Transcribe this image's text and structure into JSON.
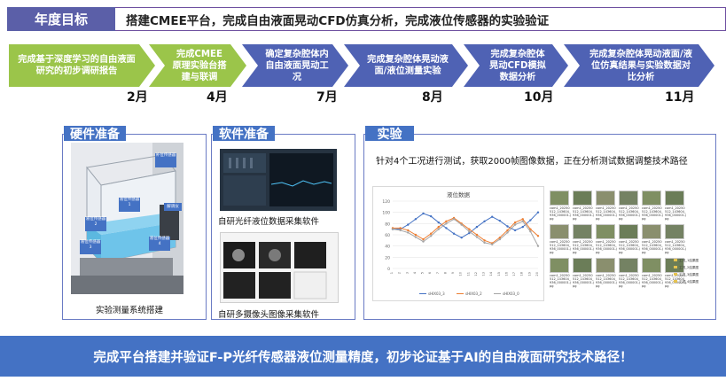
{
  "header": {
    "goal_label": "年度目标",
    "goal_text": "搭建CMEE平台，完成自由液面晃动CFD仿真分析，完成液位传感器的实验验证"
  },
  "timeline": [
    {
      "text": "完成基于深度学习的自由液面研究的初步调研报告",
      "month": "2月",
      "status": "done"
    },
    {
      "text": "完成CMEE原理实验台搭建与联调",
      "month": "4月",
      "status": "done"
    },
    {
      "text": "确定复杂腔体内自由液面晃动工况",
      "month": "7月",
      "status": "planned"
    },
    {
      "text": "完成复杂腔体晃动液面/液位测量实验",
      "month": "8月",
      "status": "planned"
    },
    {
      "text": "完成复杂腔体晃动CFD模拟数据分析",
      "month": "10月",
      "status": "planned"
    },
    {
      "text": "完成复杂腔体晃动液面/液位仿真结果与实验数据对比分析",
      "month": "11月",
      "status": "planned"
    }
  ],
  "hardware": {
    "tab": "硬件准备",
    "caption": "实验测量系统搭建",
    "labels": [
      "补位传感器",
      "液位传感器1",
      "液位传感器2",
      "液位传感器3",
      "液位传感器4",
      "解调仪"
    ]
  },
  "software": {
    "tab": "软件准备",
    "caption_top": "自研光纤液位数据采集软件",
    "caption_bottom": "自研多摄像头图像采集软件"
  },
  "experiment": {
    "tab": "实验",
    "description": "针对4个工况进行测试，获取2000帧图像数据，正在分析测试数据调整技术路径"
  },
  "chart_data": {
    "type": "line",
    "title": "液位数据",
    "x": [
      "1",
      "2",
      "3",
      "4",
      "5",
      "6",
      "7",
      "8",
      "9",
      "10",
      "11",
      "12",
      "13",
      "14",
      "15",
      "16",
      "17",
      "18",
      "19",
      "20"
    ],
    "ylim": [
      0,
      120
    ],
    "yticks": [
      0,
      20,
      40,
      60,
      80,
      100,
      120
    ],
    "series": [
      {
        "name": "sHIX03_3",
        "color": "#4472C4",
        "values": [
          70,
          70,
          78,
          88,
          98,
          93,
          82,
          72,
          62,
          55,
          63,
          74,
          84,
          92,
          85,
          75,
          68,
          74,
          86,
          100
        ]
      },
      {
        "name": "sHIX03_2",
        "color": "#ED7D31",
        "values": [
          72,
          72,
          68,
          60,
          52,
          62,
          74,
          84,
          90,
          80,
          70,
          60,
          50,
          45,
          55,
          68,
          82,
          88,
          70,
          58
        ]
      },
      {
        "name": "sHIX03_0",
        "color": "#A5A5A5",
        "values": [
          70,
          68,
          64,
          56,
          48,
          58,
          70,
          80,
          88,
          78,
          66,
          56,
          46,
          43,
          52,
          64,
          78,
          84,
          66,
          40
        ]
      }
    ],
    "legend": "bottom"
  },
  "thumbnails": {
    "count": 18,
    "label": "cam1_20250512_143604_936_000001.jpg",
    "legend": [
      "工况_1结果图",
      "工况_2结果图",
      "工况_3结果图",
      "工况_4结果图"
    ]
  },
  "banner": {
    "text": "完成平台搭建并验证F-P光纤传感器液位测量精度，初步论证基于AI的自由液面研究技术路径！"
  }
}
